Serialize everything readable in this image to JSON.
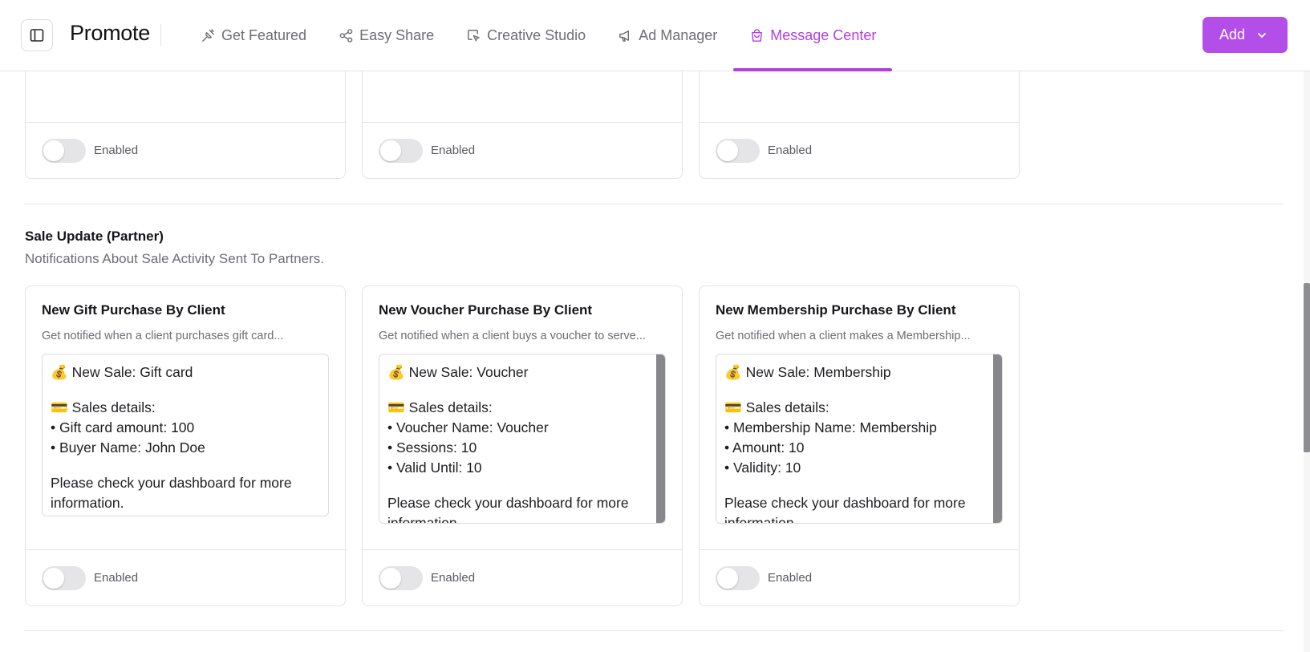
{
  "header": {
    "brand": "Promote",
    "nav": [
      {
        "label": "Get Featured",
        "icon": "sparkle-pin-icon"
      },
      {
        "label": "Easy Share",
        "icon": "share-icon"
      },
      {
        "label": "Creative Studio",
        "icon": "creative-cursor-icon"
      },
      {
        "label": "Ad Manager",
        "icon": "megaphone-icon"
      },
      {
        "label": "Message Center",
        "icon": "shopping-bag-icon",
        "active": true
      }
    ],
    "add_label": "Add"
  },
  "top_cards": [
    {
      "toggle_label": "Enabled"
    },
    {
      "toggle_label": "Enabled"
    },
    {
      "toggle_label": "Enabled"
    }
  ],
  "section": {
    "title": "Sale Update (Partner)",
    "subtitle": "Notifications About Sale Activity Sent To Partners."
  },
  "cards": [
    {
      "title": "New Gift Purchase By Client",
      "description": "Get notified when a client purchases gift card...",
      "message": {
        "headline": "💰 New Sale: Gift card",
        "details_heading": "💳 Sales details:",
        "items": [
          "• Gift card amount: 100",
          "• Buyer Name: John Doe"
        ],
        "footer": "Please check your dashboard for more information."
      },
      "toggle_label": "Enabled"
    },
    {
      "title": "New Voucher Purchase By Client",
      "description": "Get notified when a client buys a voucher to serve...",
      "message": {
        "headline": "💰 New Sale: Voucher",
        "details_heading": "💳 Sales details:",
        "items": [
          "• Voucher Name: Voucher",
          "• Sessions: 10",
          "• Valid Until: 10"
        ],
        "footer": "Please check your dashboard for more information."
      },
      "toggle_label": "Enabled"
    },
    {
      "title": "New Membership Purchase By Client",
      "description": "Get notified when a client makes a Membership...",
      "message": {
        "headline": "💰 New Sale: Membership",
        "details_heading": "💳 Sales details:",
        "items": [
          "• Membership Name: Membership",
          "• Amount: 10",
          "• Validity: 10"
        ],
        "footer": "Please check your dashboard for more information."
      },
      "toggle_label": "Enabled"
    }
  ],
  "colors": {
    "accent": "#b23ee3",
    "button": "#b44ee8",
    "border": "#e3e3e6"
  }
}
